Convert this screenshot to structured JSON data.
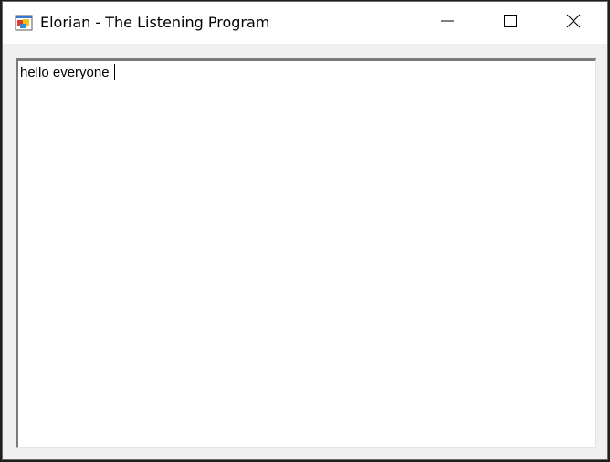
{
  "window": {
    "title": "Elorian - The Listening Program",
    "icon": "winforms-app-icon",
    "controls": {
      "minimize_icon": "minimize-icon",
      "maximize_icon": "maximize-icon",
      "close_icon": "close-icon"
    }
  },
  "textbox": {
    "value": "hello everyone "
  },
  "colors": {
    "titlebar": "#ffffff",
    "client": "#f0f0f0",
    "textbox": "#ffffff"
  }
}
